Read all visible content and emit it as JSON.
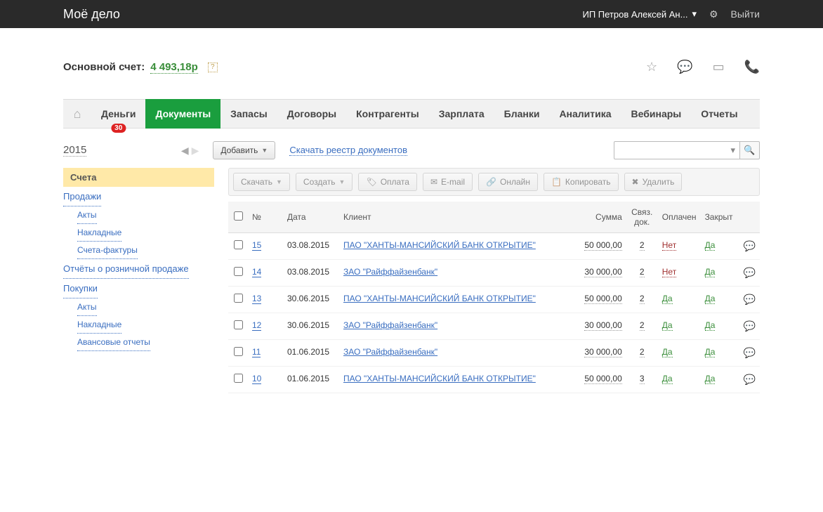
{
  "topbar": {
    "logo": "Моё дело",
    "user": "ИП Петров Алексей Ан...",
    "logout": "Выйти"
  },
  "account": {
    "label": "Основной счет:",
    "balance": "4 493,18р"
  },
  "nav": {
    "items": [
      "Деньги",
      "Документы",
      "Запасы",
      "Договоры",
      "Контрагенты",
      "Зарплата",
      "Бланки",
      "Аналитика",
      "Вебинары",
      "Отчеты"
    ],
    "badge": "30"
  },
  "subbar": {
    "year": "2015",
    "add": "Добавить",
    "download_link": "Скачать реестр документов"
  },
  "sidebar": {
    "header": "Счета",
    "links": {
      "prodazhi": "Продажи",
      "akty1": "Акты",
      "nakladnye1": "Накладные",
      "scheta_faktury": "Счета-фактуры",
      "otchety": "Отчёты о розничной продаже",
      "pokupki": "Покупки",
      "akty2": "Акты",
      "nakladnye2": "Накладные",
      "avansovye": "Авансовые отчеты"
    }
  },
  "toolbar": {
    "skachat": "Скачать",
    "sozdat": "Создать",
    "oplata": "Оплата",
    "email": "E-mail",
    "onlayn": "Онлайн",
    "kopirovat": "Копировать",
    "udalit": "Удалить"
  },
  "table": {
    "headers": {
      "num": "№",
      "date": "Дата",
      "client": "Клиент",
      "sum": "Сумма",
      "svyaz": "Связ. док.",
      "oplachen": "Оплачен",
      "zakryt": "Закрыт"
    },
    "rows": [
      {
        "num": "15",
        "date": "03.08.2015",
        "client": "ПАО \"ХАНТЫ-МАНСИЙСКИЙ БАНК ОТКРЫТИЕ\"",
        "sum": "50 000,00",
        "svyaz": "2",
        "oplachen": "Нет",
        "zakryt": "Да"
      },
      {
        "num": "14",
        "date": "03.08.2015",
        "client": "ЗАО \"Райффайзенбанк\"",
        "sum": "30 000,00",
        "svyaz": "2",
        "oplachen": "Нет",
        "zakryt": "Да"
      },
      {
        "num": "13",
        "date": "30.06.2015",
        "client": "ПАО \"ХАНТЫ-МАНСИЙСКИЙ БАНК ОТКРЫТИЕ\"",
        "sum": "50 000,00",
        "svyaz": "2",
        "oplachen": "Да",
        "zakryt": "Да"
      },
      {
        "num": "12",
        "date": "30.06.2015",
        "client": "ЗАО \"Райффайзенбанк\"",
        "sum": "30 000,00",
        "svyaz": "2",
        "oplachen": "Да",
        "zakryt": "Да"
      },
      {
        "num": "11",
        "date": "01.06.2015",
        "client": "ЗАО \"Райффайзенбанк\"",
        "sum": "30 000,00",
        "svyaz": "2",
        "oplachen": "Да",
        "zakryt": "Да"
      },
      {
        "num": "10",
        "date": "01.06.2015",
        "client": "ПАО \"ХАНТЫ-МАНСИЙСКИЙ БАНК ОТКРЫТИЕ\"",
        "sum": "50 000,00",
        "svyaz": "3",
        "oplachen": "Да",
        "zakryt": "Да"
      }
    ]
  }
}
